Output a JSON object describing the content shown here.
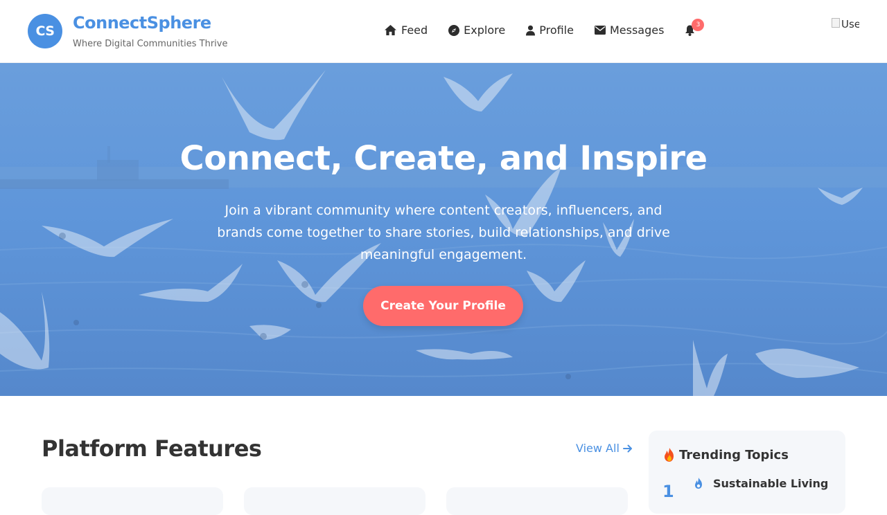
{
  "header": {
    "logo_initials": "CS",
    "brand_name": "ConnectSphere",
    "tagline": "Where Digital Communities Thrive",
    "nav": [
      {
        "label": "Feed",
        "icon": "home-icon"
      },
      {
        "label": "Explore",
        "icon": "compass-icon"
      },
      {
        "label": "Profile",
        "icon": "user-icon"
      },
      {
        "label": "Messages",
        "icon": "envelope-icon"
      }
    ],
    "notifications": {
      "icon": "bell-icon",
      "count": "3"
    },
    "avatar_alt": "User"
  },
  "hero": {
    "title": "Connect, Create, and Inspire",
    "text": "Join a vibrant community where content creators, influencers, and brands come together to share stories, build relationships, and drive meaningful engagement.",
    "cta_label": "Create Your Profile",
    "background": "seagulls-over-water-photo"
  },
  "features": {
    "title": "Platform Features",
    "view_all_label": "View All"
  },
  "trending": {
    "title": "Trending Topics",
    "items": [
      {
        "rank": "1",
        "name": "Sustainable Living",
        "icon": "flame-icon"
      }
    ]
  },
  "colors": {
    "primary": "#4a90e2",
    "accent": "#ff6b6b",
    "hero_overlay": "#5f96da",
    "panel_bg": "#f5f7fa"
  }
}
